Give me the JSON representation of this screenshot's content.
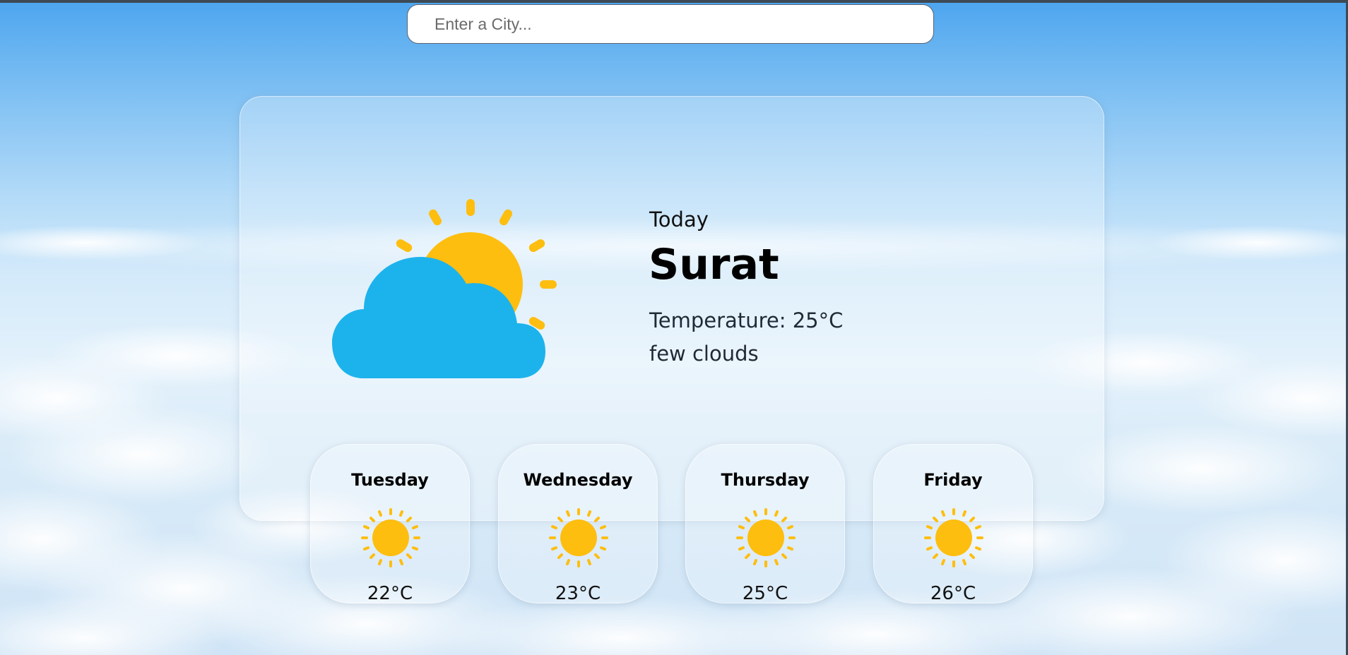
{
  "search": {
    "placeholder": "Enter a City..."
  },
  "today": {
    "label": "Today",
    "city": "Surat",
    "temperature": "Temperature: 25°C",
    "description": "few clouds",
    "icon": "partly-cloudy-icon"
  },
  "forecast": [
    {
      "day": "Tuesday",
      "temp": "22°C",
      "icon": "sun-icon"
    },
    {
      "day": "Wednesday",
      "temp": "23°C",
      "icon": "sun-icon"
    },
    {
      "day": "Thursday",
      "temp": "25°C",
      "icon": "sun-icon"
    },
    {
      "day": "Friday",
      "temp": "26°C",
      "icon": "sun-icon"
    }
  ],
  "colors": {
    "sun": "#FDBE10",
    "cloud": "#1CB3EC"
  }
}
